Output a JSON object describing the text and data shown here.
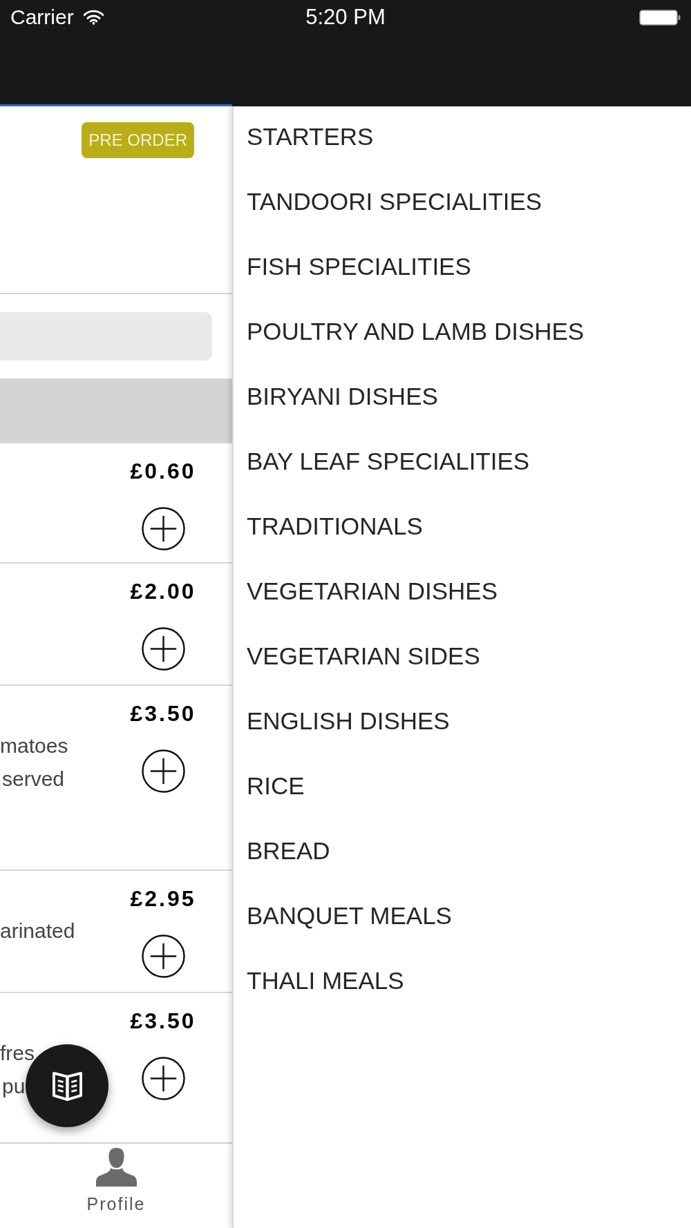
{
  "status_bar": {
    "carrier": "Carrier",
    "time": "5:20 PM"
  },
  "header": {
    "pre_order_button": "PRE ORDER"
  },
  "menu_items": [
    {
      "price": "£0.60"
    },
    {
      "price": "£2.00"
    },
    {
      "price": "£3.50",
      "description": [
        "matoes",
        "served"
      ]
    },
    {
      "price": "£2.95",
      "description": [
        "arinated"
      ]
    },
    {
      "price": "£3.50",
      "description": [
        "fres",
        "pu"
      ]
    }
  ],
  "tab_bar": [
    {
      "label": "Profile"
    }
  ],
  "category_drawer": {
    "items": [
      "STARTERS",
      "TANDOORI SPECIALITIES",
      "FISH SPECIALITIES",
      "POULTRY AND LAMB DISHES",
      "BIRYANI DISHES",
      "BAY LEAF SPECIALITIES",
      "TRADITIONALS",
      "VEGETARIAN DISHES",
      "VEGETARIAN SIDES",
      "ENGLISH DISHES",
      "RICE",
      "BREAD",
      "BANQUET MEALS",
      "THALI MEALS"
    ]
  }
}
